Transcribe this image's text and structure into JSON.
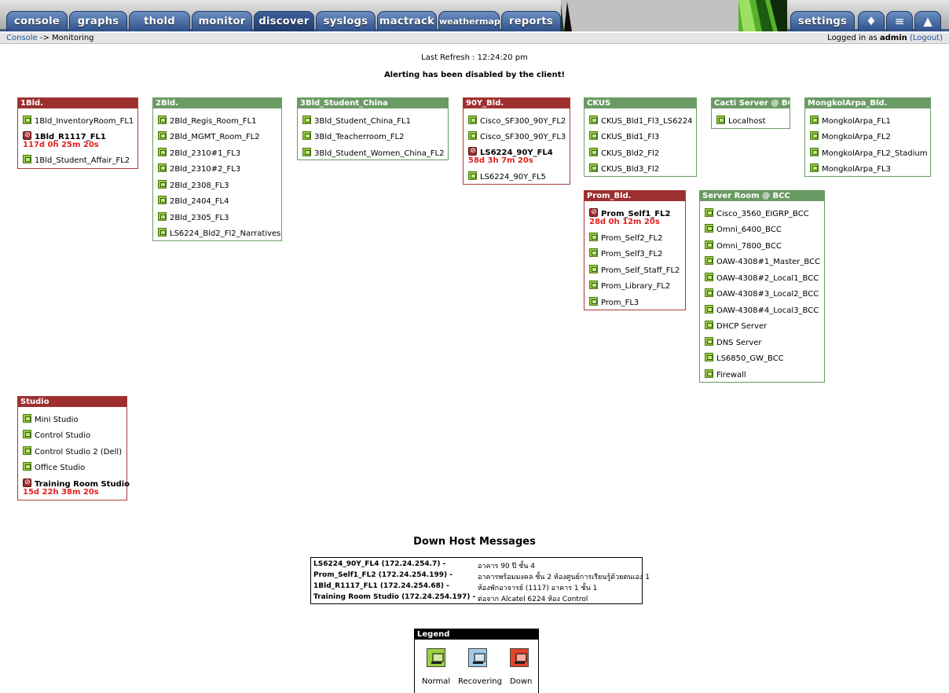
{
  "tabs": {
    "console": "console",
    "graphs": "graphs",
    "thold": "thold",
    "monitor": "monitor",
    "discover": "discover",
    "syslogs": "syslogs",
    "mactrack": "mactrack",
    "weathermap": "weathermap",
    "reports": "reports",
    "settings": "settings"
  },
  "icons": [
    "tree-view-icon",
    "list-view-icon",
    "graph-view-icon"
  ],
  "navbar": {
    "crumb_link": "Console",
    "crumb_rest": "-> Monitoring",
    "logged_in_prefix": "Logged in as",
    "user": "admin",
    "logout": "(Logout)"
  },
  "status": {
    "last_refresh": "Last Refresh : 12:24:20 pm",
    "alerting": "Alerting has been disabled by the client!"
  },
  "groups": {
    "g1bld": {
      "title": "1Bld.",
      "hosts": [
        "1Bld_InventoryRoom_FL1",
        "1Bld_R1117_FL1",
        "1Bld_Student_Affair_FL2"
      ],
      "downtime": "117d 0h 25m 20s"
    },
    "g2bld": {
      "title": "2Bld.",
      "hosts": [
        "2Bld_Regis_Room_FL1",
        "2Bld_MGMT_Room_FL2",
        "2Bld_2310#1_FL3",
        "2Bld_2310#2_FL3",
        "2Bld_2308_FL3",
        "2Bld_2404_FL4",
        "2Bld_2305_FL3",
        "LS6224_Bld2_Fl2_Narratives"
      ]
    },
    "g3bld": {
      "title": "3Bld_Student_China",
      "hosts": [
        "3Bld_Student_China_FL1",
        "3Bld_Teacherroom_FL2",
        "3Bld_Student_Women_China_FL2"
      ]
    },
    "g90y": {
      "title": "90Y_Bld.",
      "hosts": [
        "Cisco_SF300_90Y_FL2",
        "Cisco_SF300_90Y_FL3",
        "LS6224_90Y_FL4",
        "LS6224_90Y_FL5"
      ],
      "downtime": "58d 3h 7m 20s"
    },
    "gckus": {
      "title": "CKUS",
      "hosts": [
        "CKUS_Bld1_Fl3_LS6224",
        "CKUS_Bld1_Fl3",
        "CKUS_Bld2_Fl2",
        "CKUS_Bld3_Fl2"
      ]
    },
    "gcacti": {
      "title": "Cacti Server @ BCC",
      "hosts": [
        "Localhost"
      ]
    },
    "gmong": {
      "title": "MongkolArpa_Bld.",
      "hosts": [
        "MongkolArpa_FL1",
        "MongkolArpa_FL2",
        "MongkolArpa_FL2_Stadium",
        "MongkolArpa_FL3"
      ]
    },
    "gprom": {
      "title": "Prom_Bld.",
      "hosts": [
        "Prom_Self1_FL2",
        "Prom_Self2_FL2",
        "Prom_Self3_FL2",
        "Prom_Self_Staff_FL2",
        "Prom_Library_FL2",
        "Prom_FL3"
      ],
      "downtime": "28d 0h 12m 20s"
    },
    "gserver": {
      "title": "Server Room @ BCC",
      "hosts": [
        "Cisco_3560_EIGRP_BCC",
        "Omni_6400_BCC",
        "Omni_7800_BCC",
        "OAW-4308#1_Master_BCC",
        "OAW-4308#2_Local1_BCC",
        "OAW-4308#3_Local2_BCC",
        "OAW-4308#4_Local3_BCC",
        "DHCP Server",
        "DNS Server",
        "LS6850_GW_BCC",
        "Firewall"
      ]
    },
    "gstudio": {
      "title": "Studio",
      "hosts": [
        "Mini Studio",
        "Control Studio",
        "Control Studio 2 (Dell)",
        "Office Studio",
        "Training Room Studio"
      ],
      "downtime": "15d 22h 38m 20s"
    }
  },
  "down_messages": {
    "title": "Down Host Messages",
    "rows": [
      {
        "host": "LS6224_90Y_FL4 (172.24.254.7) -",
        "msg": "อาคาร 90 ปี ชั้น 4"
      },
      {
        "host": "Prom_Self1_FL2 (172.24.254.199) -",
        "msg": "อาคารพร้อมมงคล ชั้น 2 ห้องศูนย์การเรียนรู้ด้วยตนเอง 1"
      },
      {
        "host": "1Bld_R1117_FL1 (172.24.254.68) -",
        "msg": "ห้องพักอาจารย์ (1117) อาคาร 1 ชั้น 1"
      },
      {
        "host": "Training Room Studio (172.24.254.197) -",
        "msg": "ต่อจาก Alcatel 6224 ห้อง Control"
      }
    ]
  },
  "legend": {
    "title": "Legend",
    "normal": "Normal",
    "recovering": "Recovering",
    "down": "Down",
    "colors": {
      "normal": "#9ad040",
      "recovering": "#9fcbe6",
      "down": "#e2452a"
    }
  }
}
